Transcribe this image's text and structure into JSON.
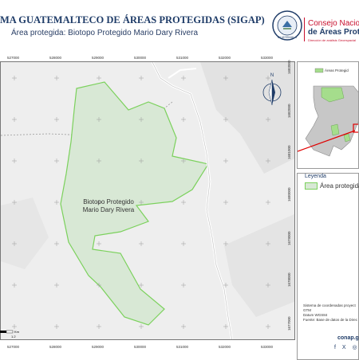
{
  "header": {
    "title": "MA GUATEMALTECO DE ÁREAS PROTEGIDAS (SIGAP)",
    "subtitle": "Área protegida: Biotopo Protegido Mario Dary Rivera",
    "org_line1": "Consejo Nacional",
    "org_line2": "de Áreas Protegi",
    "org_line3": "Dirección de análisis Geoespacial",
    "seal_text": "GUATEMALA"
  },
  "map": {
    "x_ticks": [
      "527000",
      "528000",
      "529000",
      "530000",
      "531000",
      "532000",
      "533000"
    ],
    "y_ticks": [
      "1683000",
      "1682000",
      "1681000",
      "1680000",
      "1679000",
      "1678000",
      "1677000"
    ],
    "area_label_line1": "Biotopo Protegido",
    "area_label_line2": "Mario Dary Rivera",
    "north_label": "N",
    "scale_km": "Km",
    "scale_value": "1.2"
  },
  "inset": {
    "legend_label": "Áreas Protegid"
  },
  "legend": {
    "title": "Leyenda",
    "item": "Área protegida"
  },
  "notes": {
    "line1": "Sistema de coordenadas proyect",
    "line2": "GTM",
    "line3": "Datum WGS84",
    "line4": "Fuente: Base de datos de la Direc"
  },
  "footer": {
    "url": "conap.g",
    "social": "f X ◎ ▶"
  },
  "colors": {
    "title": "#1f3c68",
    "accent_red": "#c8102e",
    "area_outline": "#7bd15c",
    "area_fill": "#d8e8d5"
  }
}
